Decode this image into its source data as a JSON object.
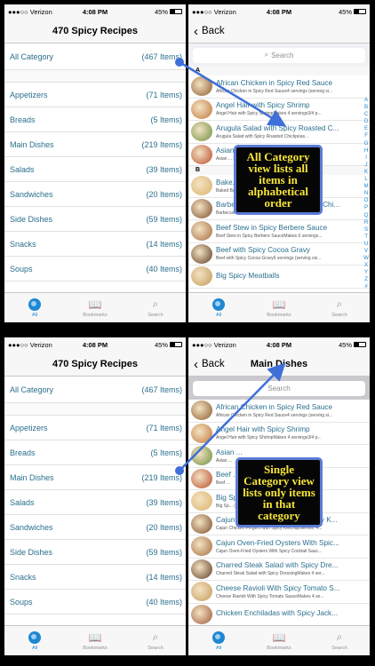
{
  "status": {
    "carrier": "●●●○○ Verizon",
    "time": "4:08 PM",
    "battery": "45%"
  },
  "tabs": [
    {
      "label": "All"
    },
    {
      "label": "Bookmarks"
    },
    {
      "label": "Search"
    }
  ],
  "app_title": "470 Spicy Recipes",
  "categories": [
    {
      "name": "All Category",
      "count": "(467 Items)"
    },
    {
      "name": "Appetizers",
      "count": "(71 Items)"
    },
    {
      "name": "Breads",
      "count": "(5 Items)"
    },
    {
      "name": "Main Dishes",
      "count": "(219 Items)"
    },
    {
      "name": "Salads",
      "count": "(39 Items)"
    },
    {
      "name": "Sandwiches",
      "count": "(20 Items)"
    },
    {
      "name": "Side Dishes",
      "count": "(59 Items)"
    },
    {
      "name": "Snacks",
      "count": "(14 Items)"
    },
    {
      "name": "Soups",
      "count": "(40 Items)"
    }
  ],
  "back_label": "Back",
  "search_placeholder": "Search",
  "main_dishes_title": "Main Dishes",
  "sections": {
    "a": "A",
    "b": "B"
  },
  "index_letters": [
    "A",
    "B",
    "C",
    "D",
    "E",
    "F",
    "G",
    "H",
    "I",
    "J",
    "K",
    "L",
    "M",
    "N",
    "O",
    "P",
    "Q",
    "R",
    "S",
    "T",
    "U",
    "V",
    "W",
    "X",
    "Y",
    "Z",
    "#"
  ],
  "all_list": [
    {
      "title": "African Chicken in Spicy Red Sauce",
      "sub": "African Chicken in Spicy Red Sauce4 servings (serving si..."
    },
    {
      "title": "Angel Hair with Spicy Shrimp",
      "sub": "Angel Hair with Spicy ShrimpMakes 4 servings3/4 p..."
    },
    {
      "title": "Arugula Salad with Spicy Roasted C...",
      "sub": "Arugula Salad with Spicy Roasted Chickpeas..."
    },
    {
      "title": "Asian ... et an...",
      "sub": "Asian ... ing..."
    },
    {
      "title": "Bake... Spicy Sou...",
      "sub": "Baked Bacon with Spicy Sour Cream Sauce..."
    },
    {
      "title": "Barbecued Spicy Apricot-Glazed Chi...",
      "sub": "Barbecued Spicy Apricot-Glazed Chicken Wings30..."
    },
    {
      "title": "Beef Stew in Spicy Berbere Sauce",
      "sub": "Beef Stew in Spicy Berbere SauceMakes 6 servings..."
    },
    {
      "title": "Beef with Spicy Cocoa Gravy",
      "sub": "Beef with Spicy Cocoa Gravy6 servings (serving siz..."
    },
    {
      "title": "Big Spicy Meatballs",
      "sub": ""
    }
  ],
  "main_list": [
    {
      "title": "African Chicken in Spicy Red Sauce",
      "sub": "African Chicken in Spicy Red Sauce4 servings (serving si..."
    },
    {
      "title": "Angel Hair with Spicy Shrimp",
      "sub": "Angel Hair with Spicy ShrimpMakes 4 servings3/4 p..."
    },
    {
      "title": "Asian ...",
      "sub": "Asian ..."
    },
    {
      "title": "Beef ...",
      "sub": "Beef ..."
    },
    {
      "title": "Big Sp...",
      "sub": "Big Sp... (Servi..."
    },
    {
      "title": "Cajun Chicken Fingers with Spicy K...",
      "sub": "Cajun Chicken Fingers with Spicy KetchupServes: 4..."
    },
    {
      "title": "Cajun Oven-Fried Oysters With Spic...",
      "sub": "Cajun Oven-Fried Oysters With Spicy Cocktail Sauc..."
    },
    {
      "title": "Charred Steak Salad with Spicy Dre...",
      "sub": "Charred Steak Salad with Spicy DressingMakes 4 ser..."
    },
    {
      "title": "Cheese Ravioli With Spicy Tomato S...",
      "sub": "Cheese Ravioli With Spicy Tomato SauceMakes 4 se..."
    },
    {
      "title": "Chicken Enchiladas with Spicy Jack...",
      "sub": ""
    }
  ],
  "callouts": {
    "all": "All Category view lists all items in alphabetical order",
    "single": "Single Category view lists only items in that category"
  },
  "colors": {
    "link": "#2a6f8e",
    "accent": "#1e88d2",
    "callout_text": "#f5e53a",
    "callout_border": "#5b7bd5"
  }
}
